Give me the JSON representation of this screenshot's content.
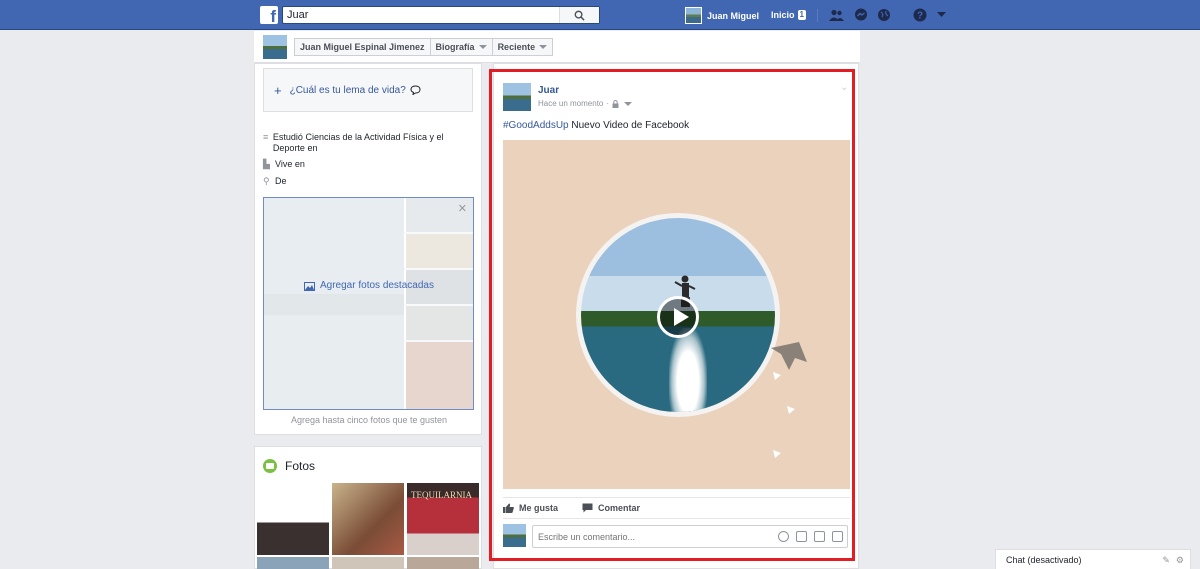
{
  "topbar": {
    "search_value": "Juar",
    "user_name": "Juan Miguel",
    "inicio_label": "Inicio",
    "inicio_badge": "1",
    "help_glyph": "?"
  },
  "subnav": {
    "profile_name": "Juan Miguel Espinal Jimenez",
    "biografia_label": "Biografía",
    "reciente_label": "Reciente"
  },
  "intro": {
    "motto_prompt": "¿Cuál es tu lema de vida?",
    "education": "Estudió Ciencias de la Actividad Física y el Deporte en",
    "lives_in": "Vive en",
    "from": "De",
    "featured_label": "Agregar fotos destacadas",
    "featured_caption": "Agrega hasta cinco fotos que te gusten"
  },
  "photos": {
    "title": "Fotos",
    "thumb_text": "TEQUILARNIA"
  },
  "post": {
    "author": "Juar",
    "time": "Hace un momento",
    "hashtag": "#GoodAddsUp",
    "text": "Nuevo Video de Facebook",
    "like_label": "Me gusta",
    "comment_label": "Comentar",
    "comment_placeholder": "Escribe un comentario..."
  },
  "chat": {
    "label": "Chat (desactivado)"
  },
  "colors": {
    "brand": "#4267b2",
    "link": "#365899",
    "highlight_frame": "#e41c24",
    "video_bg": "#ead2bc"
  },
  "icons": {
    "logo": "facebook-logo-icon",
    "search": "search-icon",
    "friends": "friends-icon",
    "messages": "messenger-icon",
    "notifications": "globe-icon",
    "help": "help-icon",
    "like": "thumbs-up-icon",
    "comment": "speech-bubble-icon"
  }
}
